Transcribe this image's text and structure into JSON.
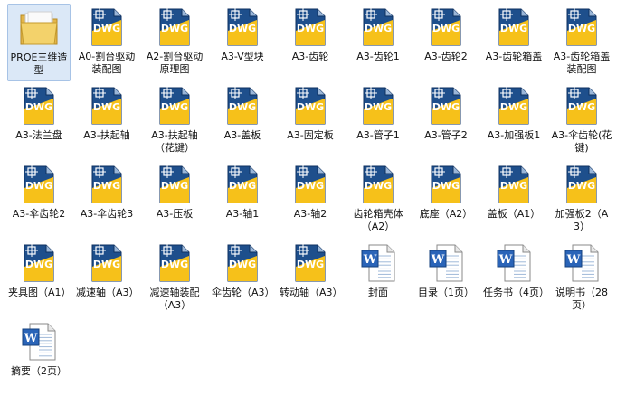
{
  "items": [
    {
      "type": "folder",
      "label": "PROE三维造型",
      "selected": true
    },
    {
      "type": "dwg",
      "label": "A0-割台驱动装配图"
    },
    {
      "type": "dwg",
      "label": "A2-割台驱动原理图"
    },
    {
      "type": "dwg",
      "label": "A3-V型块"
    },
    {
      "type": "dwg",
      "label": "A3-齿轮"
    },
    {
      "type": "dwg",
      "label": "A3-齿轮1"
    },
    {
      "type": "dwg",
      "label": "A3-齿轮2"
    },
    {
      "type": "dwg",
      "label": "A3-齿轮箱盖"
    },
    {
      "type": "dwg",
      "label": "A3-齿轮箱盖装配图"
    },
    {
      "type": "dwg",
      "label": "A3-法兰盘"
    },
    {
      "type": "dwg",
      "label": "A3-扶起轴"
    },
    {
      "type": "dwg",
      "label": "A3-扶起轴（花键）"
    },
    {
      "type": "dwg",
      "label": "A3-盖板"
    },
    {
      "type": "dwg",
      "label": "A3-固定板"
    },
    {
      "type": "dwg",
      "label": "A3-管子1"
    },
    {
      "type": "dwg",
      "label": "A3-管子2"
    },
    {
      "type": "dwg",
      "label": "A3-加强板1"
    },
    {
      "type": "dwg",
      "label": "A3-伞齿轮(花键)"
    },
    {
      "type": "dwg",
      "label": "A3-伞齿轮2"
    },
    {
      "type": "dwg",
      "label": "A3-伞齿轮3"
    },
    {
      "type": "dwg",
      "label": "A3-压板"
    },
    {
      "type": "dwg",
      "label": "A3-轴1"
    },
    {
      "type": "dwg",
      "label": "A3-轴2"
    },
    {
      "type": "dwg",
      "label": "齿轮箱壳体（A2）"
    },
    {
      "type": "dwg",
      "label": "底座（A2）"
    },
    {
      "type": "dwg",
      "label": "盖板（A1）"
    },
    {
      "type": "dwg",
      "label": "加强板2（A3）"
    },
    {
      "type": "dwg",
      "label": "夹具图（A1）"
    },
    {
      "type": "dwg",
      "label": "减速轴（A3）"
    },
    {
      "type": "dwg",
      "label": "减速轴装配（A3）"
    },
    {
      "type": "dwg",
      "label": "伞齿轮（A3）"
    },
    {
      "type": "dwg",
      "label": "转动轴（A3）"
    },
    {
      "type": "doc",
      "label": "封面"
    },
    {
      "type": "doc",
      "label": "目录（1页）"
    },
    {
      "type": "doc",
      "label": "任务书（4页）"
    },
    {
      "type": "doc",
      "label": "说明书（28页）"
    },
    {
      "type": "doc",
      "label": "摘要（2页）"
    }
  ],
  "icon_text": {
    "dwg": "DWG",
    "doc": "W"
  },
  "colors": {
    "folder": "#f3d26b",
    "dwg_blue": "#1e4f8c",
    "dwg_yellow": "#f6c11a",
    "doc_blue": "#2a64b8",
    "selection": "#dbe8f7"
  }
}
